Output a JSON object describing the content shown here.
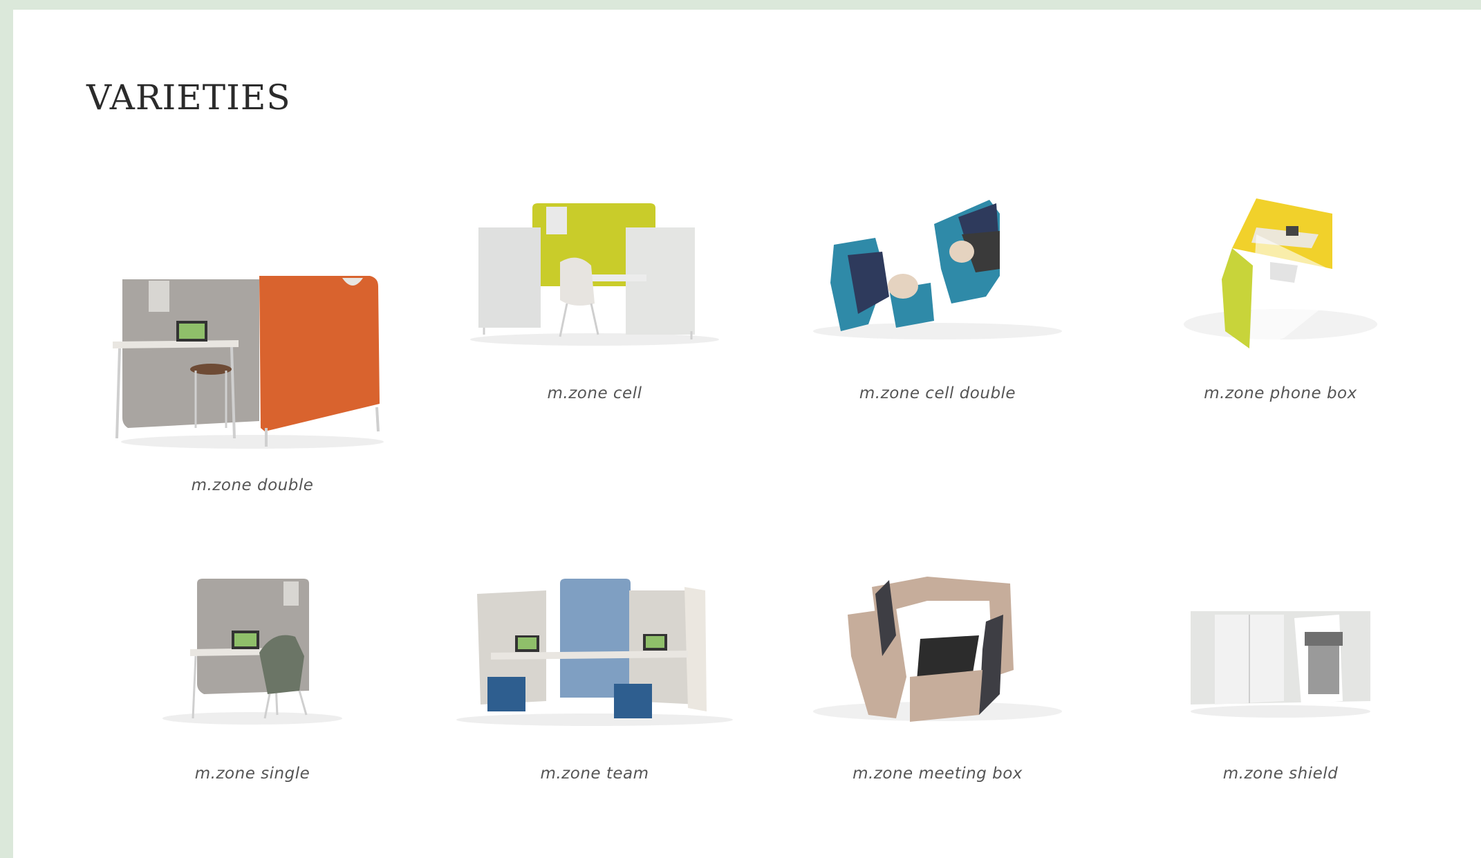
{
  "heading": "VARIETIES",
  "items": [
    {
      "label": "m.zone double",
      "colors": {
        "panel": "#a9a5a1",
        "accent": "#d9632e"
      }
    },
    {
      "label": "m.zone cell",
      "colors": {
        "panel": "#dfe0df",
        "accent": "#c9cc2a"
      }
    },
    {
      "label": "m.zone cell double",
      "colors": {
        "panel": "#2e3a5c",
        "accent": "#2f8aa8"
      }
    },
    {
      "label": "m.zone phone box",
      "colors": {
        "panel": "#c8d43a",
        "accent": "#f1d12b"
      }
    },
    {
      "label": "m.zone single",
      "colors": {
        "panel": "#a9a5a1",
        "accent": "#6b7566"
      }
    },
    {
      "label": "m.zone team",
      "colors": {
        "panel": "#d8d5cf",
        "accent": "#7f9fc2"
      }
    },
    {
      "label": "m.zone meeting box",
      "colors": {
        "panel": "#c6ad9b",
        "accent": "#3e3e44"
      }
    },
    {
      "label": "m.zone shield",
      "colors": {
        "panel": "#e4e5e3",
        "accent": "#9a9a9a"
      }
    }
  ]
}
